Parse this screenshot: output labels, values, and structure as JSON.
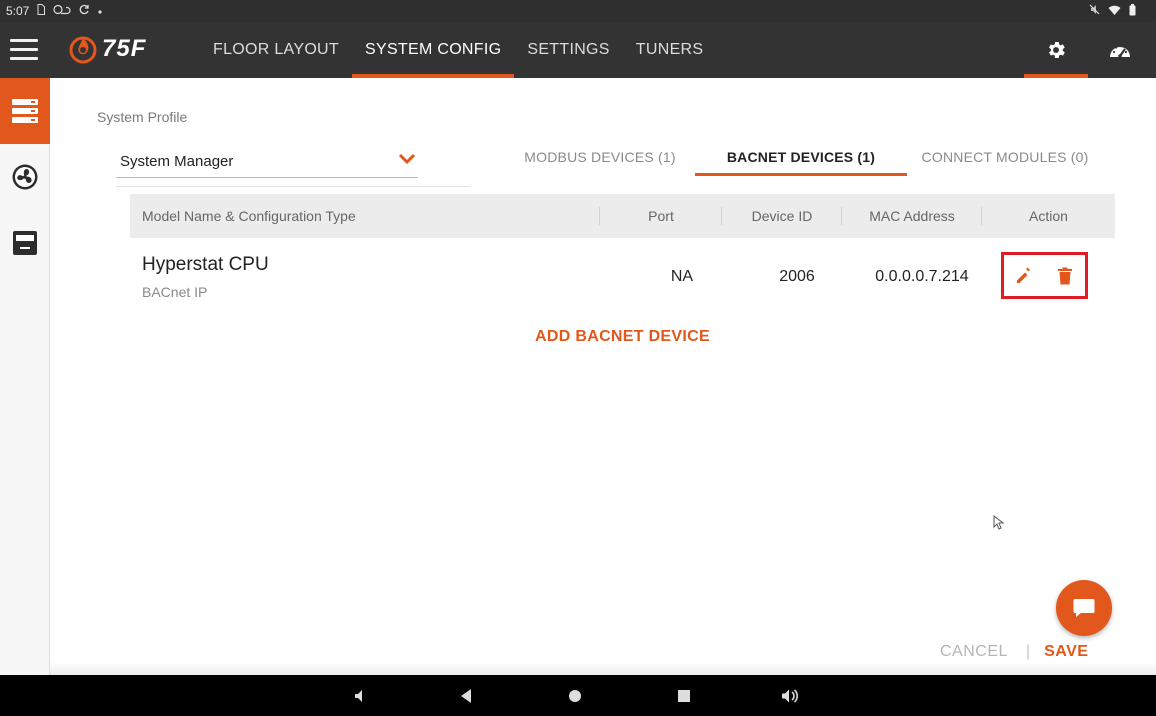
{
  "status_bar": {
    "time": "5:07",
    "icons": [
      "sim-icon",
      "cloud-icon",
      "sync-icon",
      "dot-icon",
      "mute-icon",
      "wifi-icon",
      "battery-icon"
    ]
  },
  "app_bar": {
    "logo_text": "75F",
    "nav": [
      {
        "label": "FLOOR LAYOUT",
        "active": false
      },
      {
        "label": "SYSTEM CONFIG",
        "active": true
      },
      {
        "label": "SETTINGS",
        "active": false
      },
      {
        "label": "TUNERS",
        "active": false
      }
    ],
    "right_icons": [
      "gear-icon",
      "dashboard-gauge-icon"
    ]
  },
  "side_rail": {
    "items": [
      {
        "icon": "system-stack-icon",
        "active": true
      },
      {
        "icon": "fan-icon",
        "active": false
      },
      {
        "icon": "thermostat-device-icon",
        "active": false
      }
    ]
  },
  "system_profile": {
    "label": "System Profile",
    "selected": "System Manager"
  },
  "device_tabs": [
    {
      "label": "MODBUS DEVICES (1)",
      "active": false
    },
    {
      "label": "BACNET DEVICES (1)",
      "active": true
    },
    {
      "label": "CONNECT MODULES (0)",
      "active": false
    }
  ],
  "table": {
    "headers": [
      "Model Name & Configuration Type",
      "Port",
      "Device ID",
      "MAC Address",
      "Action"
    ],
    "rows": [
      {
        "name": "Hyperstat CPU",
        "type": "BACnet IP",
        "port": "NA",
        "device_id": "2006",
        "mac": "0.0.0.0.7.214"
      }
    ]
  },
  "add_device_label": "ADD BACNET DEVICE",
  "footer": {
    "cancel": "CANCEL",
    "divider": "|",
    "save": "SAVE"
  },
  "colors": {
    "accent": "#e2581c",
    "highlight_box": "#e01b24",
    "app_bar": "#333333"
  }
}
